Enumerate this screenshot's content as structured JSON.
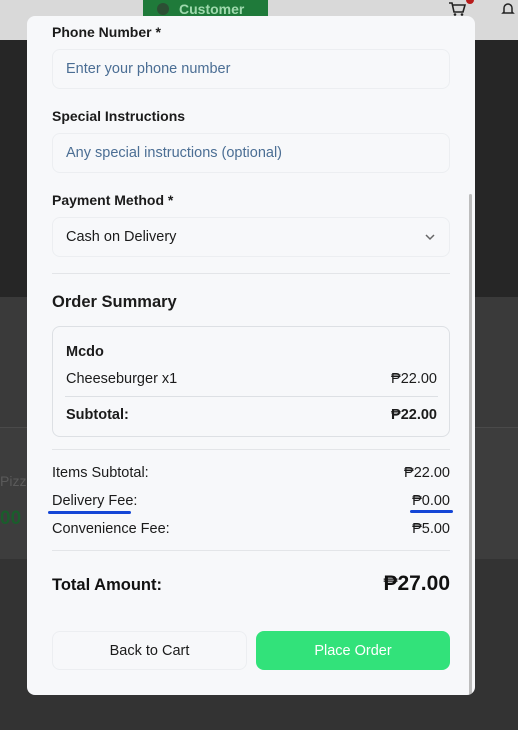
{
  "background": {
    "header_badge_label": "Customer",
    "partial_item_text": "Pizza",
    "partial_price_text": "00"
  },
  "colors": {
    "accent_green": "#32e27a",
    "annotation_blue": "#1446d6",
    "placeholder_blue": "#4b6e94"
  },
  "form": {
    "phone": {
      "label": "Phone Number *",
      "placeholder": "Enter your phone number",
      "value": ""
    },
    "instructions": {
      "label": "Special Instructions",
      "placeholder": "Any special instructions (optional)",
      "value": ""
    },
    "payment": {
      "label": "Payment Method *",
      "selected": "Cash on Delivery",
      "icon": "chevron-down-icon"
    }
  },
  "summary": {
    "title": "Order Summary",
    "shop_name": "Mcdo",
    "items": [
      {
        "name": "Cheeseburger x1",
        "price": "₱22.00"
      }
    ],
    "subtotal_label": "Subtotal:",
    "subtotal_value": "₱22.00"
  },
  "totals": {
    "items_subtotal_label": "Items Subtotal:",
    "items_subtotal_value": "₱22.00",
    "delivery_fee_label": "Delivery Fee:",
    "delivery_fee_value": "₱0.00",
    "convenience_fee_label": "Convenience Fee:",
    "convenience_fee_value": "₱5.00",
    "total_label": "Total Amount:",
    "total_value": "₱27.00"
  },
  "actions": {
    "back_label": "Back to Cart",
    "place_label": "Place Order"
  }
}
